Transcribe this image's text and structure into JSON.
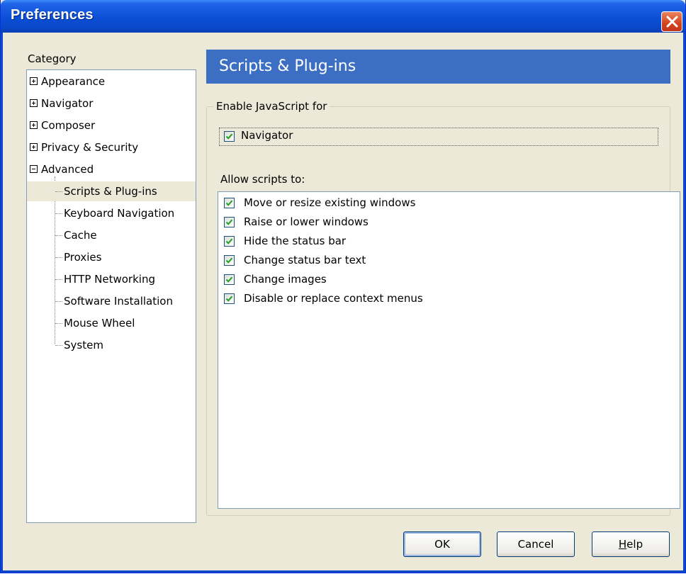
{
  "window": {
    "title": "Preferences"
  },
  "category": {
    "label": "Category",
    "items": [
      {
        "label": "Appearance",
        "expander": "plus"
      },
      {
        "label": "Navigator",
        "expander": "plus"
      },
      {
        "label": "Composer",
        "expander": "plus"
      },
      {
        "label": "Privacy & Security",
        "expander": "plus"
      },
      {
        "label": "Advanced",
        "expander": "minus"
      }
    ],
    "children": [
      {
        "label": "Scripts & Plug-ins",
        "selected": true
      },
      {
        "label": "Keyboard Navigation"
      },
      {
        "label": "Cache"
      },
      {
        "label": "Proxies"
      },
      {
        "label": "HTTP Networking"
      },
      {
        "label": "Software Installation"
      },
      {
        "label": "Mouse Wheel"
      },
      {
        "label": "System"
      }
    ]
  },
  "panel": {
    "title": "Scripts & Plug-ins",
    "enable_group": "Enable JavaScript for",
    "enable_navigator": {
      "label": "Navigator",
      "checked": true
    },
    "allow_label": "Allow scripts to:",
    "permissions": [
      {
        "label": "Move or resize existing windows",
        "checked": true
      },
      {
        "label": "Raise or lower windows",
        "checked": true
      },
      {
        "label": "Hide the status bar",
        "checked": true
      },
      {
        "label": "Change status bar text",
        "checked": true
      },
      {
        "label": "Change images",
        "checked": true
      },
      {
        "label": "Disable or replace context menus",
        "checked": true
      }
    ]
  },
  "buttons": {
    "ok": "OK",
    "cancel": "Cancel",
    "help_mnemonic": "H",
    "help_rest": "elp"
  },
  "colors": {
    "titlebar": "#0a47c9",
    "panel_header": "#3c6fc3",
    "dialog_bg": "#ece9d8",
    "check": "#21a121"
  }
}
